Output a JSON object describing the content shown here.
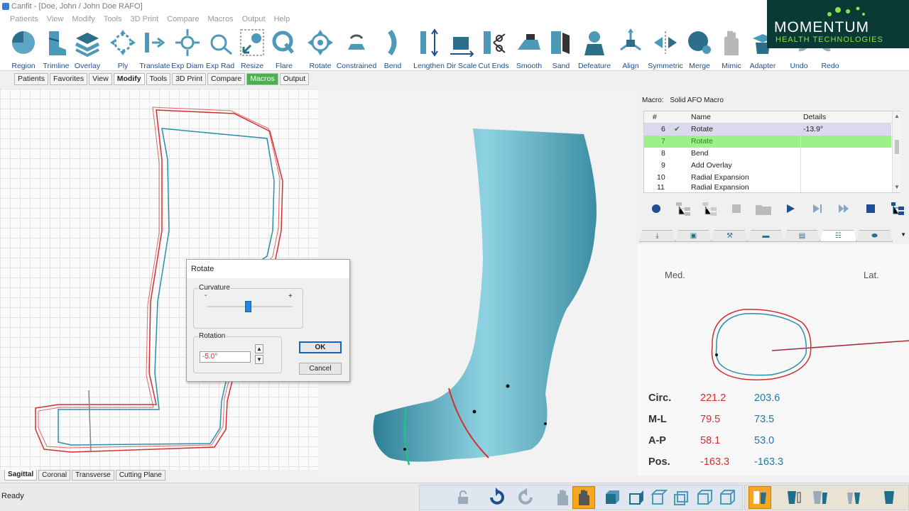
{
  "window": {
    "title": "Canfit - [Doe, John / John Doe RAFO]"
  },
  "menu": [
    "Patients",
    "View",
    "Modify",
    "Tools",
    "3D Print",
    "Compare",
    "Macros",
    "Output",
    "Help"
  ],
  "ribbon": {
    "tools": [
      {
        "name": "region",
        "label": "Region"
      },
      {
        "name": "trimline",
        "label": "Trimline"
      },
      {
        "name": "overlay",
        "label": "Overlay"
      },
      {
        "name": "ply",
        "label": "Ply"
      },
      {
        "name": "translate",
        "label": "Translate"
      },
      {
        "name": "exp-diam",
        "label": "Exp Diam"
      },
      {
        "name": "exp-rad",
        "label": "Exp Rad"
      },
      {
        "name": "resize",
        "label": "Resize"
      },
      {
        "name": "flare",
        "label": "Flare"
      },
      {
        "name": "rotate",
        "label": "Rotate"
      },
      {
        "name": "constrained",
        "label": "Constrained"
      },
      {
        "name": "bend",
        "label": "Bend"
      },
      {
        "name": "lengthen",
        "label": "Lengthen"
      },
      {
        "name": "dir-scale",
        "label": "Dir Scale"
      },
      {
        "name": "cut-ends",
        "label": "Cut Ends"
      },
      {
        "name": "smooth",
        "label": "Smooth"
      },
      {
        "name": "sand",
        "label": "Sand"
      },
      {
        "name": "defeature",
        "label": "Defeature"
      },
      {
        "name": "align",
        "label": "Align"
      },
      {
        "name": "symmetric",
        "label": "Symmetric"
      },
      {
        "name": "merge",
        "label": "Merge"
      },
      {
        "name": "mimic",
        "label": "Mimic"
      },
      {
        "name": "adapter",
        "label": "Adapter"
      },
      {
        "name": "undo",
        "label": "Undo"
      },
      {
        "name": "redo",
        "label": "Redo"
      }
    ]
  },
  "logo": {
    "line1": "MOMENTUM",
    "line2": "HEALTH TECHNOLOGIES"
  },
  "tabs": [
    "Patients",
    "Favorites",
    "View",
    "Modify",
    "Tools",
    "3D Print",
    "Compare",
    "Macros",
    "Output"
  ],
  "view_tabs": [
    "Sagittal",
    "Coronal",
    "Transverse",
    "Cutting Plane"
  ],
  "dialog": {
    "title": "Rotate",
    "curvature_label": "Curvature",
    "minus": "-",
    "plus": "+",
    "rotation_label": "Rotation",
    "rotation_value": "-5.0°",
    "ok": "OK",
    "cancel": "Cancel"
  },
  "macro": {
    "label": "Macro:",
    "name": "Solid AFO Macro",
    "columns": [
      "#",
      "Name",
      "Details"
    ],
    "rows": [
      {
        "num": "6",
        "name": "Rotate",
        "details": "-13.9°",
        "done": true
      },
      {
        "num": "7",
        "name": "Rotate",
        "details": ""
      },
      {
        "num": "8",
        "name": "Bend",
        "details": ""
      },
      {
        "num": "9",
        "name": "Add Overlay",
        "details": ""
      },
      {
        "num": "10",
        "name": "Radial Expansion",
        "details": ""
      },
      {
        "num": "11",
        "name": "Radial Expansion",
        "details": ""
      }
    ]
  },
  "crosssection": {
    "med": "Med.",
    "lat": "Lat.",
    "measurements": [
      {
        "label": "Circ.",
        "red": "221.2",
        "blue": "203.6"
      },
      {
        "label": "M-L",
        "red": "79.5",
        "blue": "73.5"
      },
      {
        "label": "A-P",
        "red": "58.1",
        "blue": "53.0"
      },
      {
        "label": "Pos.",
        "red": "-163.3",
        "blue": "-163.3"
      }
    ]
  },
  "status": {
    "text": "Ready"
  },
  "colors": {
    "accent": "#4caf50",
    "red_outline": "#d32f2f",
    "blue_outline": "#2a8fa8",
    "model": "#5fb3c6",
    "logo_bg": "#0b3a36"
  }
}
